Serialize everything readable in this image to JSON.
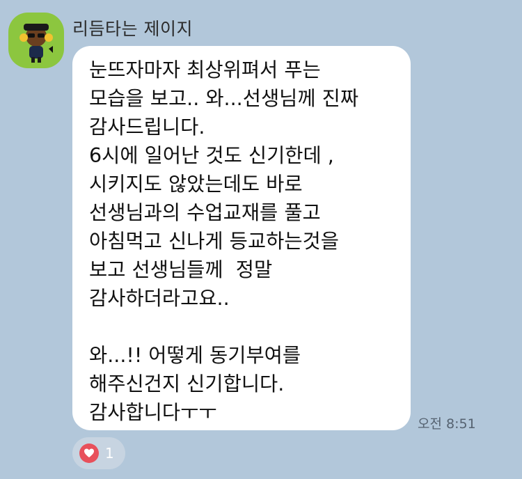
{
  "chat": {
    "sender_name": "리듬타는 제이지",
    "avatar_icon": "character-avatar-icon",
    "message_lines": [
      "눈뜨자마자 최상위펴서 푸는",
      "모습을 보고.. 와...선생님께 진짜",
      "감사드립니다.",
      "6시에 일어난 것도 신기한데 ,",
      "시키지도 않았는데도 바로",
      "선생님과의 수업교재를 풀고",
      "아침먹고 신나게 등교하는것을",
      "보고 선생님들께  정말",
      "감사하더라고요..",
      "",
      "와...!! 어떻게 동기부여를",
      "해주신건지 신기합니다.",
      "감사합니다ㅜㅜ"
    ],
    "timestamp": "오전 8:51",
    "reaction": {
      "icon": "heart-icon",
      "count": "1"
    }
  },
  "colors": {
    "background": "#b2c7da",
    "bubble": "#ffffff",
    "avatar_bg": "#8cc63f",
    "heart": "#e8505b"
  }
}
